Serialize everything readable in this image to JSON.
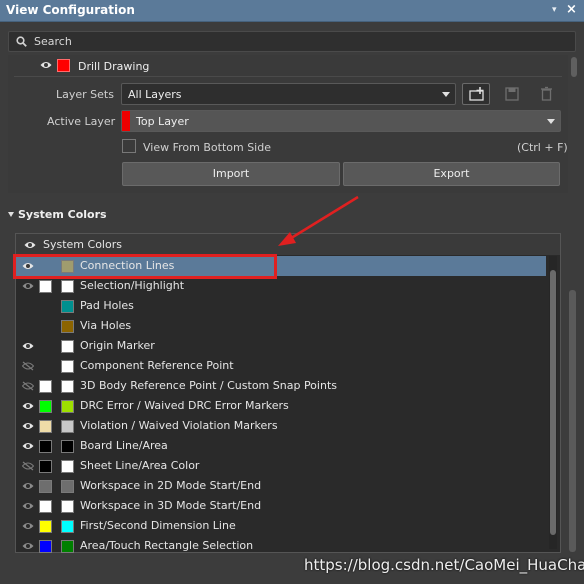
{
  "window": {
    "title": "View Configuration",
    "pin_glyph": "▾",
    "close_glyph": "×"
  },
  "search": {
    "placeholder": "Search"
  },
  "layer_row": {
    "label": "Drill Drawing",
    "color": "#ff0000"
  },
  "layer_sets": {
    "label": "Layer Sets",
    "value": "All Layers"
  },
  "active_layer": {
    "label": "Active Layer",
    "value": "Top Layer",
    "color": "#ee0000"
  },
  "view_from_bottom": {
    "label": "View From Bottom Side",
    "shortcut": "(Ctrl + F)",
    "checked": false
  },
  "buttons": {
    "import": "Import",
    "export": "Export"
  },
  "system_colors": {
    "section_title": "System Colors",
    "list_header": "System Colors",
    "items": [
      {
        "label": "Connection Lines",
        "eye": "visible",
        "color1": null,
        "color2": "#a09c6e",
        "selected": true
      },
      {
        "label": "Selection/Highlight",
        "eye": "visible-dim",
        "color1": "#ffffff",
        "color2": "#ffffff"
      },
      {
        "label": "Pad Holes",
        "eye": "none",
        "color1": null,
        "color2": "#00908f"
      },
      {
        "label": "Via Holes",
        "eye": "none",
        "color1": null,
        "color2": "#8c6400"
      },
      {
        "label": "Origin Marker",
        "eye": "visible",
        "color1": null,
        "color2": "#ffffff"
      },
      {
        "label": "Component Reference Point",
        "eye": "hidden",
        "color1": null,
        "color2": "#ffffff"
      },
      {
        "label": "3D Body Reference Point / Custom Snap Points",
        "eye": "hidden",
        "color1": "#ffffff",
        "color2": "#ffffff"
      },
      {
        "label": "DRC Error / Waived DRC Error Markers",
        "eye": "visible",
        "color1": "#00ff00",
        "color2": "#9ee000"
      },
      {
        "label": "Violation / Waived Violation Markers",
        "eye": "visible",
        "color1": "#efdca8",
        "color2": "#c8c8c8"
      },
      {
        "label": "Board Line/Area",
        "eye": "visible",
        "color1": "#000000",
        "color2": "#000000"
      },
      {
        "label": "Sheet Line/Area Color",
        "eye": "hidden",
        "color1": "#000000",
        "color2": "#ffffff"
      },
      {
        "label": "Workspace in 2D Mode Start/End",
        "eye": "visible-dim",
        "color1": "#6e6e6e",
        "color2": "#6e6e6e"
      },
      {
        "label": "Workspace in 3D Mode Start/End",
        "eye": "visible-dim",
        "color1": "#ffffff",
        "color2": "#ffffff"
      },
      {
        "label": "First/Second Dimension Line",
        "eye": "visible-dim",
        "color1": "#ffff00",
        "color2": "#00ffff"
      },
      {
        "label": "Area/Touch Rectangle Selection",
        "eye": "visible-dim",
        "color1": "#0000ff",
        "color2": "#008000"
      }
    ]
  },
  "watermark": "https://blog.csdn.net/CaoMei_HuaCha-"
}
